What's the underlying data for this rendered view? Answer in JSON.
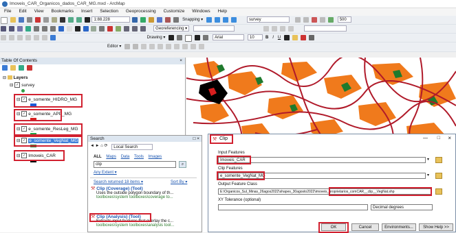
{
  "window": {
    "title": "Imoveis_CAR_Organicos_dados_CAR_MG.mxd - ArcMap"
  },
  "menu": [
    "File",
    "Edit",
    "View",
    "Bookmarks",
    "Insert",
    "Selection",
    "Geoprocessing",
    "Customize",
    "Windows",
    "Help"
  ],
  "toolbar": {
    "scale": "1:88.228",
    "snapping": "Snapping ▾",
    "layer_select": "survey",
    "zoom_value": "500",
    "georef": "Georeferencing ▾",
    "drawing": "Drawing ▾",
    "font": "Arial",
    "font_size": "10",
    "editor": "Editor ▾"
  },
  "toc": {
    "title": "Table Of Contents",
    "group": "Layers",
    "layers": [
      {
        "name": "survey",
        "color": "#2f9e44"
      },
      {
        "name": "e_somente_HIDRO_MG",
        "color": "#1e5bd6"
      },
      {
        "name": "e_somente_APP_MG",
        "color": "#d81f1f"
      },
      {
        "name": "e_somente_ResLeg_MG",
        "color": "#24a34a"
      },
      {
        "name": "e_somente_VegNat_MG",
        "color": "#1f7a2d"
      },
      {
        "name": "Imoveis_CAR",
        "color": "#000000"
      }
    ]
  },
  "search": {
    "title": "Search",
    "local": "Local Search",
    "tabs": [
      "ALL",
      "Maps",
      "Data",
      "Tools",
      "Images"
    ],
    "query": "clip",
    "any_extent": "Any Extent ▾",
    "returned": "Search returned 18 items ▾",
    "sort": "Sort By ▾",
    "results": [
      {
        "title": "Clip (Coverage) (Tool)",
        "desc": "Uses the outside polygon boundary of th...",
        "path": "toolboxes\\system toolboxes\\coverage to..."
      },
      {
        "title": "Clip (Analysis) (Tool)",
        "desc": "Extracts input features that overlay the c...",
        "path": "toolboxes\\system toolboxes\\analysis tool..."
      }
    ]
  },
  "clip_dialog": {
    "title": "Clip",
    "input_label": "Input Features",
    "input_value": "Imoveis_CAR",
    "clip_label": "Clip Features",
    "clip_value": "e_somente_VegNat_MG",
    "output_label": "Output Feature Class",
    "output_path": "E:\\Organicos_Sul_Minas_26agos2022\\shapes_30agosto2022",
    "output_file": "\\imoveis_proprietarios_comCAR__clip__VegNat.shp",
    "xy_label": "XY Tolerance (optional)",
    "units": "Decimal degrees",
    "buttons": {
      "ok": "OK",
      "cancel": "Cancel",
      "env": "Environments...",
      "help": "Show Help >>"
    }
  }
}
